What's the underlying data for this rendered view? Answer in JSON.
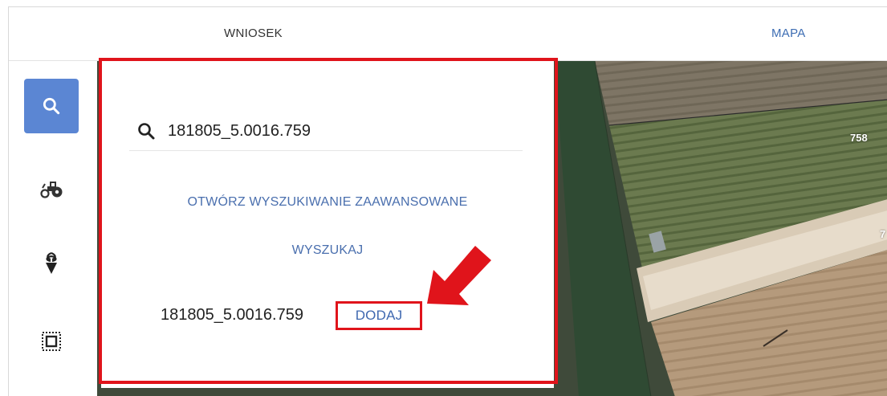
{
  "tabs": {
    "wniosek": "WNIOSEK",
    "mapa": "MAPA"
  },
  "toolbar": {
    "items": [
      {
        "icon": "search-icon",
        "active": true
      },
      {
        "icon": "tractor-icon",
        "active": false
      },
      {
        "icon": "crop-plant-icon",
        "active": false
      },
      {
        "icon": "parcel-select-icon",
        "active": false
      }
    ]
  },
  "search": {
    "icon": "search-icon",
    "value": "181805_5.0016.759",
    "advanced_link": "OTWÓRZ WYSZUKIWANIE ZAAWANSOWANE",
    "submit_label": "WYSZUKAJ"
  },
  "result": {
    "parcel_id": "181805_5.0016.759",
    "add_label": "DODAJ"
  },
  "map": {
    "labels": [
      "758",
      "7"
    ]
  },
  "colors": {
    "accent": "#5b86d3",
    "link": "#4a6fae",
    "highlight": "#e0141b"
  }
}
